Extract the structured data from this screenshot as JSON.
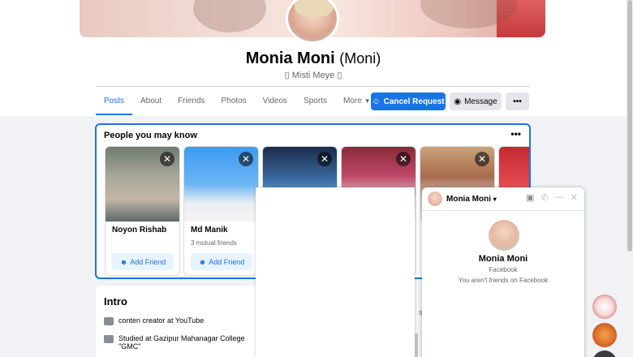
{
  "profile": {
    "name": "Monia Moni",
    "nickname": "(Moni)",
    "bio": "▯ Misti Meye ▯"
  },
  "tabs": [
    {
      "label": "Posts"
    },
    {
      "label": "About"
    },
    {
      "label": "Friends"
    },
    {
      "label": "Photos"
    },
    {
      "label": "Videos"
    },
    {
      "label": "Sports"
    },
    {
      "label": "More"
    }
  ],
  "actions": {
    "cancel_request": "Cancel Request",
    "message": "Message",
    "more": "•••"
  },
  "pymk": {
    "title": "People you may know",
    "menu": "•••",
    "cards": [
      {
        "name": "Noyon Rishab",
        "mutual": "",
        "add": "Add Friend"
      },
      {
        "name": "Md Manik",
        "mutual": "3 mutual friends",
        "add": "Add Friend"
      }
    ]
  },
  "intro": {
    "title": "Intro",
    "work": "conten creator at",
    "work_place": "YouTube",
    "study": "Studied at",
    "study_place": "Gazipur Mahanagar College",
    "study_place_2": "\"GMC\""
  },
  "chat": {
    "name": "Monia Moni",
    "platform": "Facebook",
    "note": "You aren't friends on Facebook"
  },
  "peek": "s"
}
